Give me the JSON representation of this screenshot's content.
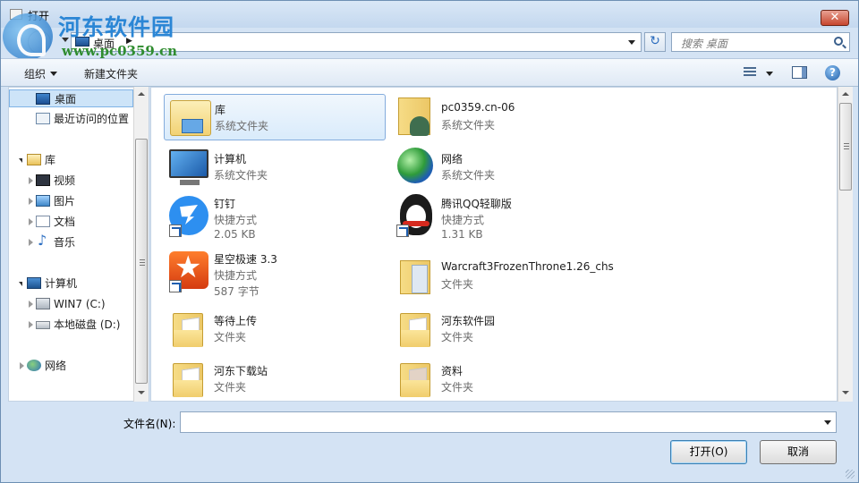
{
  "window": {
    "title": "打开",
    "close_label": "✕"
  },
  "watermark": {
    "title": "河东软件园",
    "url": "www.pc0359.cn"
  },
  "address": {
    "location": "桌面",
    "search_placeholder": "搜索 桌面",
    "refresh_glyph": "↻"
  },
  "toolbar": {
    "organize_label": "组织",
    "new_folder_label": "新建文件夹",
    "help_glyph": "?"
  },
  "sidebar": {
    "items": [
      {
        "label": "桌面",
        "icon": "desktop-icon",
        "selected": true
      },
      {
        "label": "最近访问的位置",
        "icon": "recent-places-icon"
      },
      {
        "label": "库",
        "icon": "libraries-icon",
        "expanded": true
      },
      {
        "label": "视频",
        "icon": "video-icon"
      },
      {
        "label": "图片",
        "icon": "pictures-icon"
      },
      {
        "label": "文档",
        "icon": "documents-icon"
      },
      {
        "label": "音乐",
        "icon": "music-icon"
      },
      {
        "label": "计算机",
        "icon": "computer-icon",
        "expanded": true
      },
      {
        "label": "WIN7 (C:)",
        "icon": "drive-c-icon"
      },
      {
        "label": "本地磁盘 (D:)",
        "icon": "drive-d-icon"
      },
      {
        "label": "网络",
        "icon": "network-icon"
      }
    ]
  },
  "files": [
    {
      "name": "库",
      "type": "系统文件夹",
      "icon": "library-folder-icon",
      "selected": true
    },
    {
      "name": "pc0359.cn-06",
      "type": "系统文件夹",
      "icon": "user-folder-icon"
    },
    {
      "name": "计算机",
      "type": "系统文件夹",
      "icon": "computer-icon"
    },
    {
      "name": "网络",
      "type": "系统文件夹",
      "icon": "network-globe-icon"
    },
    {
      "name": "钉钉",
      "type": "快捷方式",
      "size": "2.05 KB",
      "icon": "dingtalk-icon"
    },
    {
      "name": "腾讯QQ轻聊版",
      "type": "快捷方式",
      "size": "1.31 KB",
      "icon": "qq-penguin-icon"
    },
    {
      "name": "星空极速 3.3",
      "type": "快捷方式",
      "size": "587 字节",
      "icon": "star-speed-icon"
    },
    {
      "name": "Warcraft3FrozenThrone1.26_chs",
      "type": "文件夹",
      "icon": "folder-icon"
    },
    {
      "name": "等待上传",
      "type": "文件夹",
      "icon": "folder-icon"
    },
    {
      "name": "河东软件园",
      "type": "文件夹",
      "icon": "folder-icon"
    },
    {
      "name": "河东下载站",
      "type": "文件夹",
      "icon": "folder-icon"
    },
    {
      "name": "资料",
      "type": "文件夹",
      "icon": "folder-icon"
    }
  ],
  "footer": {
    "filename_label": "文件名(N):",
    "filename_value": "",
    "open_label": "打开(O)",
    "cancel_label": "取消"
  },
  "colors": {
    "accent": "#2b86d5",
    "selection": "#cde4f8",
    "window_frame": "#d4e3f4"
  }
}
